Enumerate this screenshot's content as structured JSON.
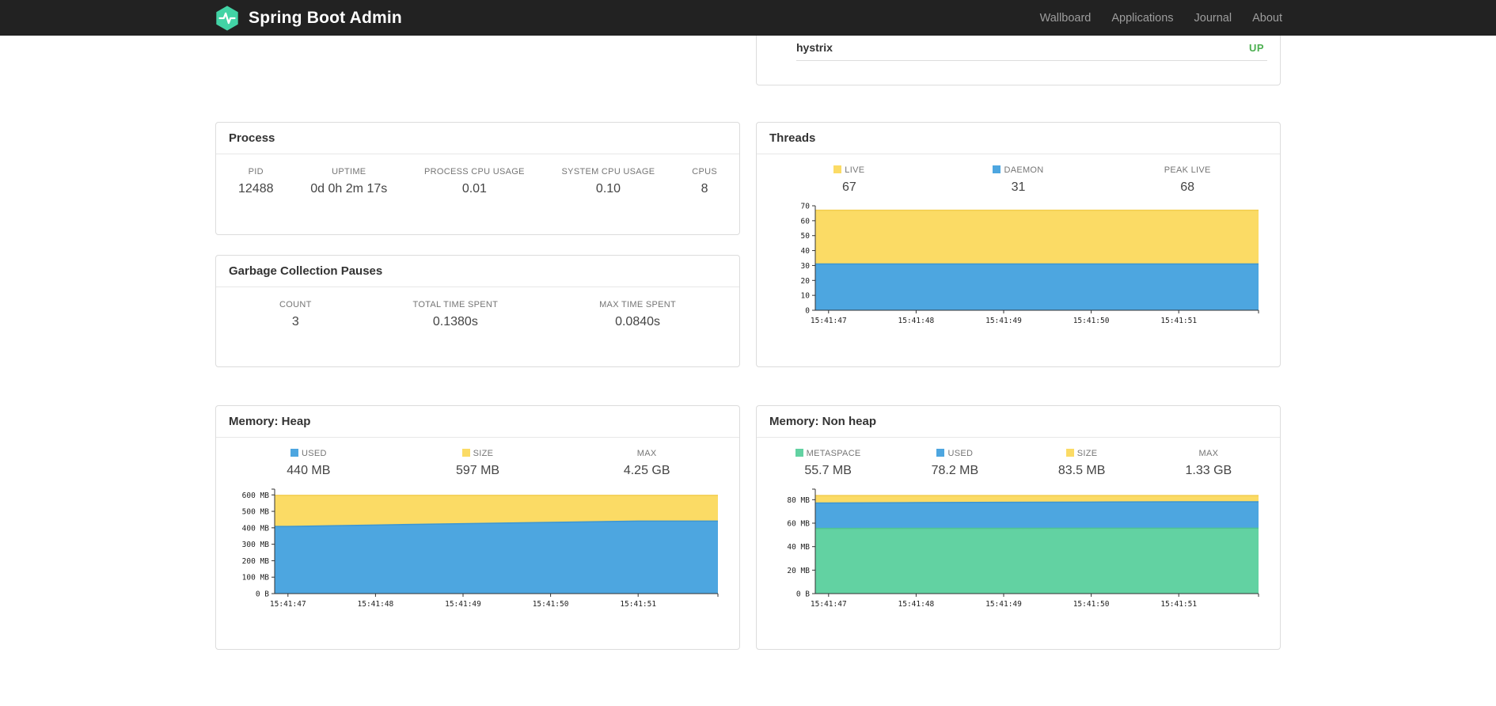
{
  "navbar": {
    "brand": "Spring Boot Admin",
    "links": [
      {
        "label": "Wallboard"
      },
      {
        "label": "Applications"
      },
      {
        "label": "Journal"
      },
      {
        "label": "About"
      }
    ]
  },
  "colors": {
    "brand_green": "#42d3a5",
    "status_up": "#4caf50",
    "series_yellow": "#fbdb65",
    "series_blue": "#4da6e0",
    "series_green": "#62d2a2",
    "navbar_bg": "#222222"
  },
  "status_card": {
    "service": "hystrix",
    "status": "UP",
    "status_color": "#4caf50"
  },
  "process": {
    "title": "Process",
    "metrics": [
      {
        "label": "PID",
        "value": "12488"
      },
      {
        "label": "UPTIME",
        "value": "0d 0h 2m 17s"
      },
      {
        "label": "PROCESS CPU USAGE",
        "value": "0.01"
      },
      {
        "label": "SYSTEM CPU USAGE",
        "value": "0.10"
      },
      {
        "label": "CPUS",
        "value": "8"
      }
    ]
  },
  "gc": {
    "title": "Garbage Collection Pauses",
    "metrics": [
      {
        "label": "COUNT",
        "value": "3"
      },
      {
        "label": "TOTAL TIME SPENT",
        "value": "0.1380s"
      },
      {
        "label": "MAX TIME SPENT",
        "value": "0.0840s"
      }
    ]
  },
  "threads": {
    "title": "Threads",
    "legend": [
      {
        "label": "LIVE",
        "value": "67",
        "swatch": "#fbdb65"
      },
      {
        "label": "DAEMON",
        "value": "31",
        "swatch": "#4da6e0"
      },
      {
        "label": "PEAK LIVE",
        "value": "68",
        "swatch": null
      }
    ]
  },
  "heap": {
    "title": "Memory: Heap",
    "legend": [
      {
        "label": "USED",
        "value": "440 MB",
        "swatch": "#4da6e0"
      },
      {
        "label": "SIZE",
        "value": "597 MB",
        "swatch": "#fbdb65"
      },
      {
        "label": "MAX",
        "value": "4.25 GB",
        "swatch": null
      }
    ]
  },
  "nonheap": {
    "title": "Memory: Non heap",
    "legend": [
      {
        "label": "METASPACE",
        "value": "55.7 MB",
        "swatch": "#62d2a2"
      },
      {
        "label": "USED",
        "value": "78.2 MB",
        "swatch": "#4da6e0"
      },
      {
        "label": "SIZE",
        "value": "83.5 MB",
        "swatch": "#fbdb65"
      },
      {
        "label": "MAX",
        "value": "1.33 GB",
        "swatch": null
      }
    ]
  },
  "chart_data": [
    {
      "id": "threads-chart",
      "type": "area",
      "title": "Threads",
      "x": [
        "15:41:47",
        "15:41:48",
        "15:41:49",
        "15:41:50",
        "15:41:51"
      ],
      "ylim": [
        0,
        70
      ],
      "yticks": [
        {
          "v": 0,
          "label": "0"
        },
        {
          "v": 10,
          "label": "10"
        },
        {
          "v": 20,
          "label": "20"
        },
        {
          "v": 30,
          "label": "30"
        },
        {
          "v": 40,
          "label": "40"
        },
        {
          "v": 50,
          "label": "50"
        },
        {
          "v": 60,
          "label": "60"
        },
        {
          "v": 70,
          "label": "70"
        }
      ],
      "series": [
        {
          "name": "LIVE",
          "color": "#fbdb65",
          "line": "#f2cd4e",
          "values": [
            67,
            67,
            67,
            67,
            67
          ]
        },
        {
          "name": "DAEMON",
          "color": "#4da6e0",
          "line": "#3d96d2",
          "values": [
            31,
            31,
            31,
            31,
            31
          ]
        }
      ]
    },
    {
      "id": "heap-chart",
      "type": "area",
      "title": "Memory: Heap (MB)",
      "x": [
        "15:41:47",
        "15:41:48",
        "15:41:49",
        "15:41:50",
        "15:41:51"
      ],
      "ylim": [
        0,
        635
      ],
      "yticks": [
        {
          "v": 0,
          "label": "0 B"
        },
        {
          "v": 100,
          "label": "100 MB"
        },
        {
          "v": 200,
          "label": "200 MB"
        },
        {
          "v": 300,
          "label": "300 MB"
        },
        {
          "v": 400,
          "label": "400 MB"
        },
        {
          "v": 500,
          "label": "500 MB"
        },
        {
          "v": 600,
          "label": "600 MB"
        }
      ],
      "series": [
        {
          "name": "SIZE",
          "color": "#fbdb65",
          "line": "#f2cd4e",
          "values": [
            597,
            597,
            597,
            597,
            597
          ]
        },
        {
          "name": "USED",
          "color": "#4da6e0",
          "line": "#3d96d2",
          "values": [
            408,
            417,
            425,
            433,
            441
          ]
        }
      ]
    },
    {
      "id": "nonheap-chart",
      "type": "area",
      "title": "Memory: Non heap (MB)",
      "x": [
        "15:41:47",
        "15:41:48",
        "15:41:49",
        "15:41:50",
        "15:41:51"
      ],
      "ylim": [
        0,
        89
      ],
      "yticks": [
        {
          "v": 0,
          "label": "0 B"
        },
        {
          "v": 20,
          "label": "20 MB"
        },
        {
          "v": 40,
          "label": "40 MB"
        },
        {
          "v": 60,
          "label": "60 MB"
        },
        {
          "v": 80,
          "label": "80 MB"
        }
      ],
      "series": [
        {
          "name": "SIZE",
          "color": "#fbdb65",
          "line": "#f2cd4e",
          "values": [
            83.5,
            83.5,
            83.5,
            83.5,
            83.5
          ]
        },
        {
          "name": "USED",
          "color": "#4da6e0",
          "line": "#3d96d2",
          "values": [
            77.2,
            77.5,
            77.8,
            78.0,
            78.2
          ]
        },
        {
          "name": "METASPACE",
          "color": "#62d2a2",
          "line": "#4fc492",
          "values": [
            55.5,
            55.6,
            55.6,
            55.7,
            55.7
          ]
        }
      ]
    }
  ]
}
